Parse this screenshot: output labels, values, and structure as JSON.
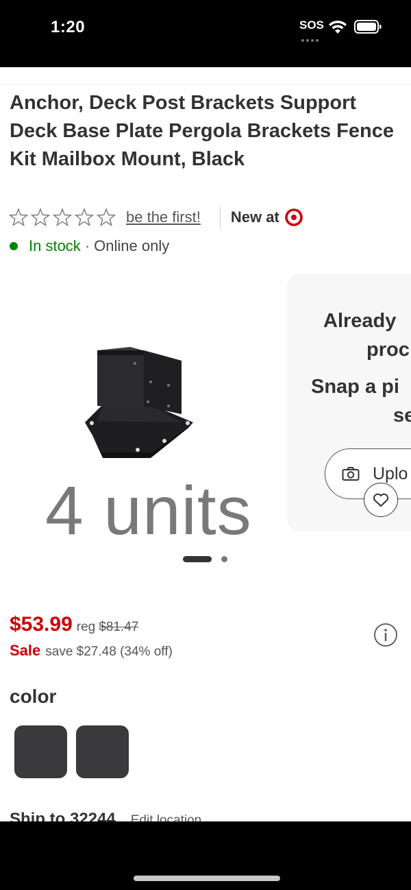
{
  "status_bar": {
    "time": "1:20",
    "sos": "SOS"
  },
  "product": {
    "title": "Anchor, Deck Post Brackets Support Deck Base Plate Pergola Brackets Fence Kit Mailbox Mount, Black",
    "rating": {
      "stars_filled": 0,
      "stars_total": 5,
      "review_prompt": "be the first!"
    },
    "new_at_label": "New at",
    "brand_color": "#cc0000",
    "stock": {
      "status": "In stock",
      "separator": "·",
      "channel": "Online only",
      "status_color": "#008300"
    }
  },
  "gallery": {
    "image_caption": "4 units",
    "slide_count": 2,
    "active_slide": 1
  },
  "upload_card": {
    "heading_line1": "Already",
    "heading_line2": "proc",
    "body_line1": "Snap a pi",
    "body_line2": "se",
    "button_label": "Uplo",
    "button_icon": "camera-icon"
  },
  "pricing": {
    "current_price": "$53.99",
    "reg_label": "reg",
    "reg_price": "$81.47",
    "sale_label": "Sale",
    "save_text": "save $27.48 (34% off)",
    "price_color": "#cc0000"
  },
  "color": {
    "label": "color",
    "swatches": [
      "#3a3a3c",
      "#3a3a3c"
    ]
  },
  "shipping": {
    "ship_to": "Ship to 32244",
    "edit_location": "Edit location"
  }
}
